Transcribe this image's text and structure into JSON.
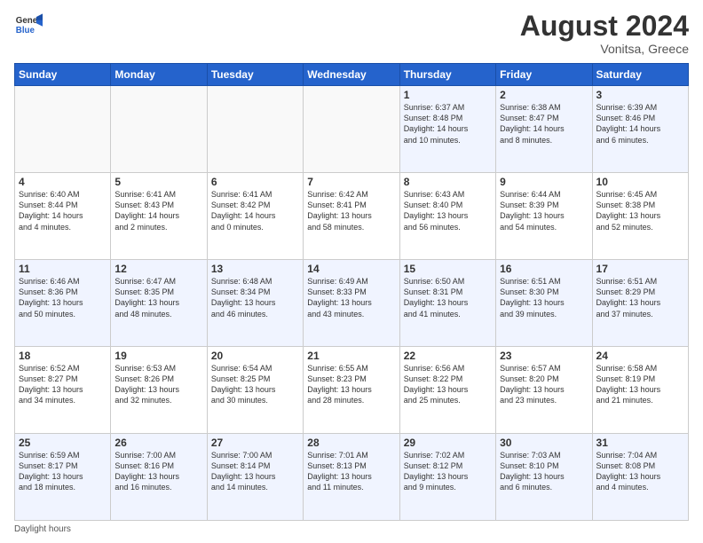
{
  "header": {
    "logo_general": "General",
    "logo_blue": "Blue",
    "month_year": "August 2024",
    "location": "Vonitsa, Greece"
  },
  "footer": {
    "note": "Daylight hours"
  },
  "days_of_week": [
    "Sunday",
    "Monday",
    "Tuesday",
    "Wednesday",
    "Thursday",
    "Friday",
    "Saturday"
  ],
  "weeks": [
    [
      {
        "day": "",
        "info": ""
      },
      {
        "day": "",
        "info": ""
      },
      {
        "day": "",
        "info": ""
      },
      {
        "day": "",
        "info": ""
      },
      {
        "day": "1",
        "info": "Sunrise: 6:37 AM\nSunset: 8:48 PM\nDaylight: 14 hours\nand 10 minutes."
      },
      {
        "day": "2",
        "info": "Sunrise: 6:38 AM\nSunset: 8:47 PM\nDaylight: 14 hours\nand 8 minutes."
      },
      {
        "day": "3",
        "info": "Sunrise: 6:39 AM\nSunset: 8:46 PM\nDaylight: 14 hours\nand 6 minutes."
      }
    ],
    [
      {
        "day": "4",
        "info": "Sunrise: 6:40 AM\nSunset: 8:44 PM\nDaylight: 14 hours\nand 4 minutes."
      },
      {
        "day": "5",
        "info": "Sunrise: 6:41 AM\nSunset: 8:43 PM\nDaylight: 14 hours\nand 2 minutes."
      },
      {
        "day": "6",
        "info": "Sunrise: 6:41 AM\nSunset: 8:42 PM\nDaylight: 14 hours\nand 0 minutes."
      },
      {
        "day": "7",
        "info": "Sunrise: 6:42 AM\nSunset: 8:41 PM\nDaylight: 13 hours\nand 58 minutes."
      },
      {
        "day": "8",
        "info": "Sunrise: 6:43 AM\nSunset: 8:40 PM\nDaylight: 13 hours\nand 56 minutes."
      },
      {
        "day": "9",
        "info": "Sunrise: 6:44 AM\nSunset: 8:39 PM\nDaylight: 13 hours\nand 54 minutes."
      },
      {
        "day": "10",
        "info": "Sunrise: 6:45 AM\nSunset: 8:38 PM\nDaylight: 13 hours\nand 52 minutes."
      }
    ],
    [
      {
        "day": "11",
        "info": "Sunrise: 6:46 AM\nSunset: 8:36 PM\nDaylight: 13 hours\nand 50 minutes."
      },
      {
        "day": "12",
        "info": "Sunrise: 6:47 AM\nSunset: 8:35 PM\nDaylight: 13 hours\nand 48 minutes."
      },
      {
        "day": "13",
        "info": "Sunrise: 6:48 AM\nSunset: 8:34 PM\nDaylight: 13 hours\nand 46 minutes."
      },
      {
        "day": "14",
        "info": "Sunrise: 6:49 AM\nSunset: 8:33 PM\nDaylight: 13 hours\nand 43 minutes."
      },
      {
        "day": "15",
        "info": "Sunrise: 6:50 AM\nSunset: 8:31 PM\nDaylight: 13 hours\nand 41 minutes."
      },
      {
        "day": "16",
        "info": "Sunrise: 6:51 AM\nSunset: 8:30 PM\nDaylight: 13 hours\nand 39 minutes."
      },
      {
        "day": "17",
        "info": "Sunrise: 6:51 AM\nSunset: 8:29 PM\nDaylight: 13 hours\nand 37 minutes."
      }
    ],
    [
      {
        "day": "18",
        "info": "Sunrise: 6:52 AM\nSunset: 8:27 PM\nDaylight: 13 hours\nand 34 minutes."
      },
      {
        "day": "19",
        "info": "Sunrise: 6:53 AM\nSunset: 8:26 PM\nDaylight: 13 hours\nand 32 minutes."
      },
      {
        "day": "20",
        "info": "Sunrise: 6:54 AM\nSunset: 8:25 PM\nDaylight: 13 hours\nand 30 minutes."
      },
      {
        "day": "21",
        "info": "Sunrise: 6:55 AM\nSunset: 8:23 PM\nDaylight: 13 hours\nand 28 minutes."
      },
      {
        "day": "22",
        "info": "Sunrise: 6:56 AM\nSunset: 8:22 PM\nDaylight: 13 hours\nand 25 minutes."
      },
      {
        "day": "23",
        "info": "Sunrise: 6:57 AM\nSunset: 8:20 PM\nDaylight: 13 hours\nand 23 minutes."
      },
      {
        "day": "24",
        "info": "Sunrise: 6:58 AM\nSunset: 8:19 PM\nDaylight: 13 hours\nand 21 minutes."
      }
    ],
    [
      {
        "day": "25",
        "info": "Sunrise: 6:59 AM\nSunset: 8:17 PM\nDaylight: 13 hours\nand 18 minutes."
      },
      {
        "day": "26",
        "info": "Sunrise: 7:00 AM\nSunset: 8:16 PM\nDaylight: 13 hours\nand 16 minutes."
      },
      {
        "day": "27",
        "info": "Sunrise: 7:00 AM\nSunset: 8:14 PM\nDaylight: 13 hours\nand 14 minutes."
      },
      {
        "day": "28",
        "info": "Sunrise: 7:01 AM\nSunset: 8:13 PM\nDaylight: 13 hours\nand 11 minutes."
      },
      {
        "day": "29",
        "info": "Sunrise: 7:02 AM\nSunset: 8:12 PM\nDaylight: 13 hours\nand 9 minutes."
      },
      {
        "day": "30",
        "info": "Sunrise: 7:03 AM\nSunset: 8:10 PM\nDaylight: 13 hours\nand 6 minutes."
      },
      {
        "day": "31",
        "info": "Sunrise: 7:04 AM\nSunset: 8:08 PM\nDaylight: 13 hours\nand 4 minutes."
      }
    ]
  ]
}
